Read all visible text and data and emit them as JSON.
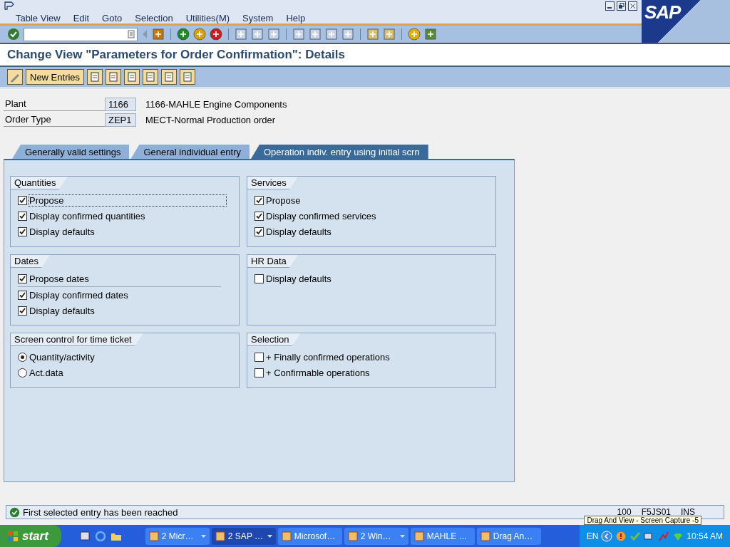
{
  "menu": [
    "Table View",
    "Edit",
    "Goto",
    "Selection",
    "Utilities(M)",
    "System",
    "Help"
  ],
  "logo": "SAP",
  "title": "Change View \"Parameters for Order Confirmation\": Details",
  "app_toolbar": {
    "new_entries": "New Entries"
  },
  "header_fields": [
    {
      "label": "Plant",
      "value": "1166",
      "description": "1166-MAHLE Engine Components"
    },
    {
      "label": "Order Type",
      "value": "ZEP1",
      "description": "MECT-Normal Production order"
    }
  ],
  "tabs": [
    {
      "label": "Generally valid settings",
      "selected": false
    },
    {
      "label": "General individual entry",
      "selected": false
    },
    {
      "label": "Operation indiv. entry using initial scrn",
      "selected": true
    }
  ],
  "groups": [
    {
      "title": "Quantities",
      "items": [
        {
          "kind": "checkbox",
          "label": "Propose",
          "checked": true
        },
        {
          "kind": "checkbox",
          "label": "Display confirmed quantities",
          "checked": true
        },
        {
          "kind": "checkbox",
          "label": "Display defaults",
          "checked": true
        }
      ]
    },
    {
      "title": "Services",
      "items": [
        {
          "kind": "checkbox",
          "label": "Propose",
          "checked": true
        },
        {
          "kind": "checkbox",
          "label": "Display confirmed services",
          "checked": true
        },
        {
          "kind": "checkbox",
          "label": "Display defaults",
          "checked": true
        }
      ]
    },
    {
      "title": "Dates",
      "items": [
        {
          "kind": "checkbox",
          "label": "Propose dates",
          "checked": true
        },
        {
          "kind": "checkbox",
          "label": "Display confirmed dates",
          "checked": true
        },
        {
          "kind": "checkbox",
          "label": "Display defaults",
          "checked": true
        }
      ]
    },
    {
      "title": "HR Data",
      "items": [
        {
          "kind": "checkbox",
          "label": "Display defaults",
          "checked": false
        }
      ]
    },
    {
      "title": "Screen control for time ticket",
      "items": [
        {
          "kind": "radio",
          "label": "Quantity/activity",
          "selected": true
        },
        {
          "kind": "radio",
          "label": "Act.data",
          "selected": false
        }
      ]
    },
    {
      "title": "Selection",
      "items": [
        {
          "kind": "checkbox",
          "label": "+ Finally confirmed operations",
          "checked": false
        },
        {
          "kind": "checkbox",
          "label": "+ Confirmable operations",
          "checked": false
        }
      ]
    }
  ],
  "status": {
    "message": "First selected entry has been reached",
    "fields": [
      "100",
      "F5JS01",
      "INS"
    ]
  },
  "tooltip": "Drag And View - Screen Capture -5",
  "taskbar": {
    "start": "start",
    "tasks": [
      {
        "label": "2 Micr…",
        "selected": false,
        "menu": true
      },
      {
        "label": "2 SAP …",
        "selected": true,
        "menu": true
      },
      {
        "label": "Microsof…",
        "selected": false,
        "menu": false
      },
      {
        "label": "2 Win…",
        "selected": false,
        "menu": true
      },
      {
        "label": "MAHLE …",
        "selected": false,
        "menu": false
      },
      {
        "label": "Drag An…",
        "selected": false,
        "menu": false
      }
    ],
    "language": "EN",
    "clock": "10:54 AM"
  }
}
